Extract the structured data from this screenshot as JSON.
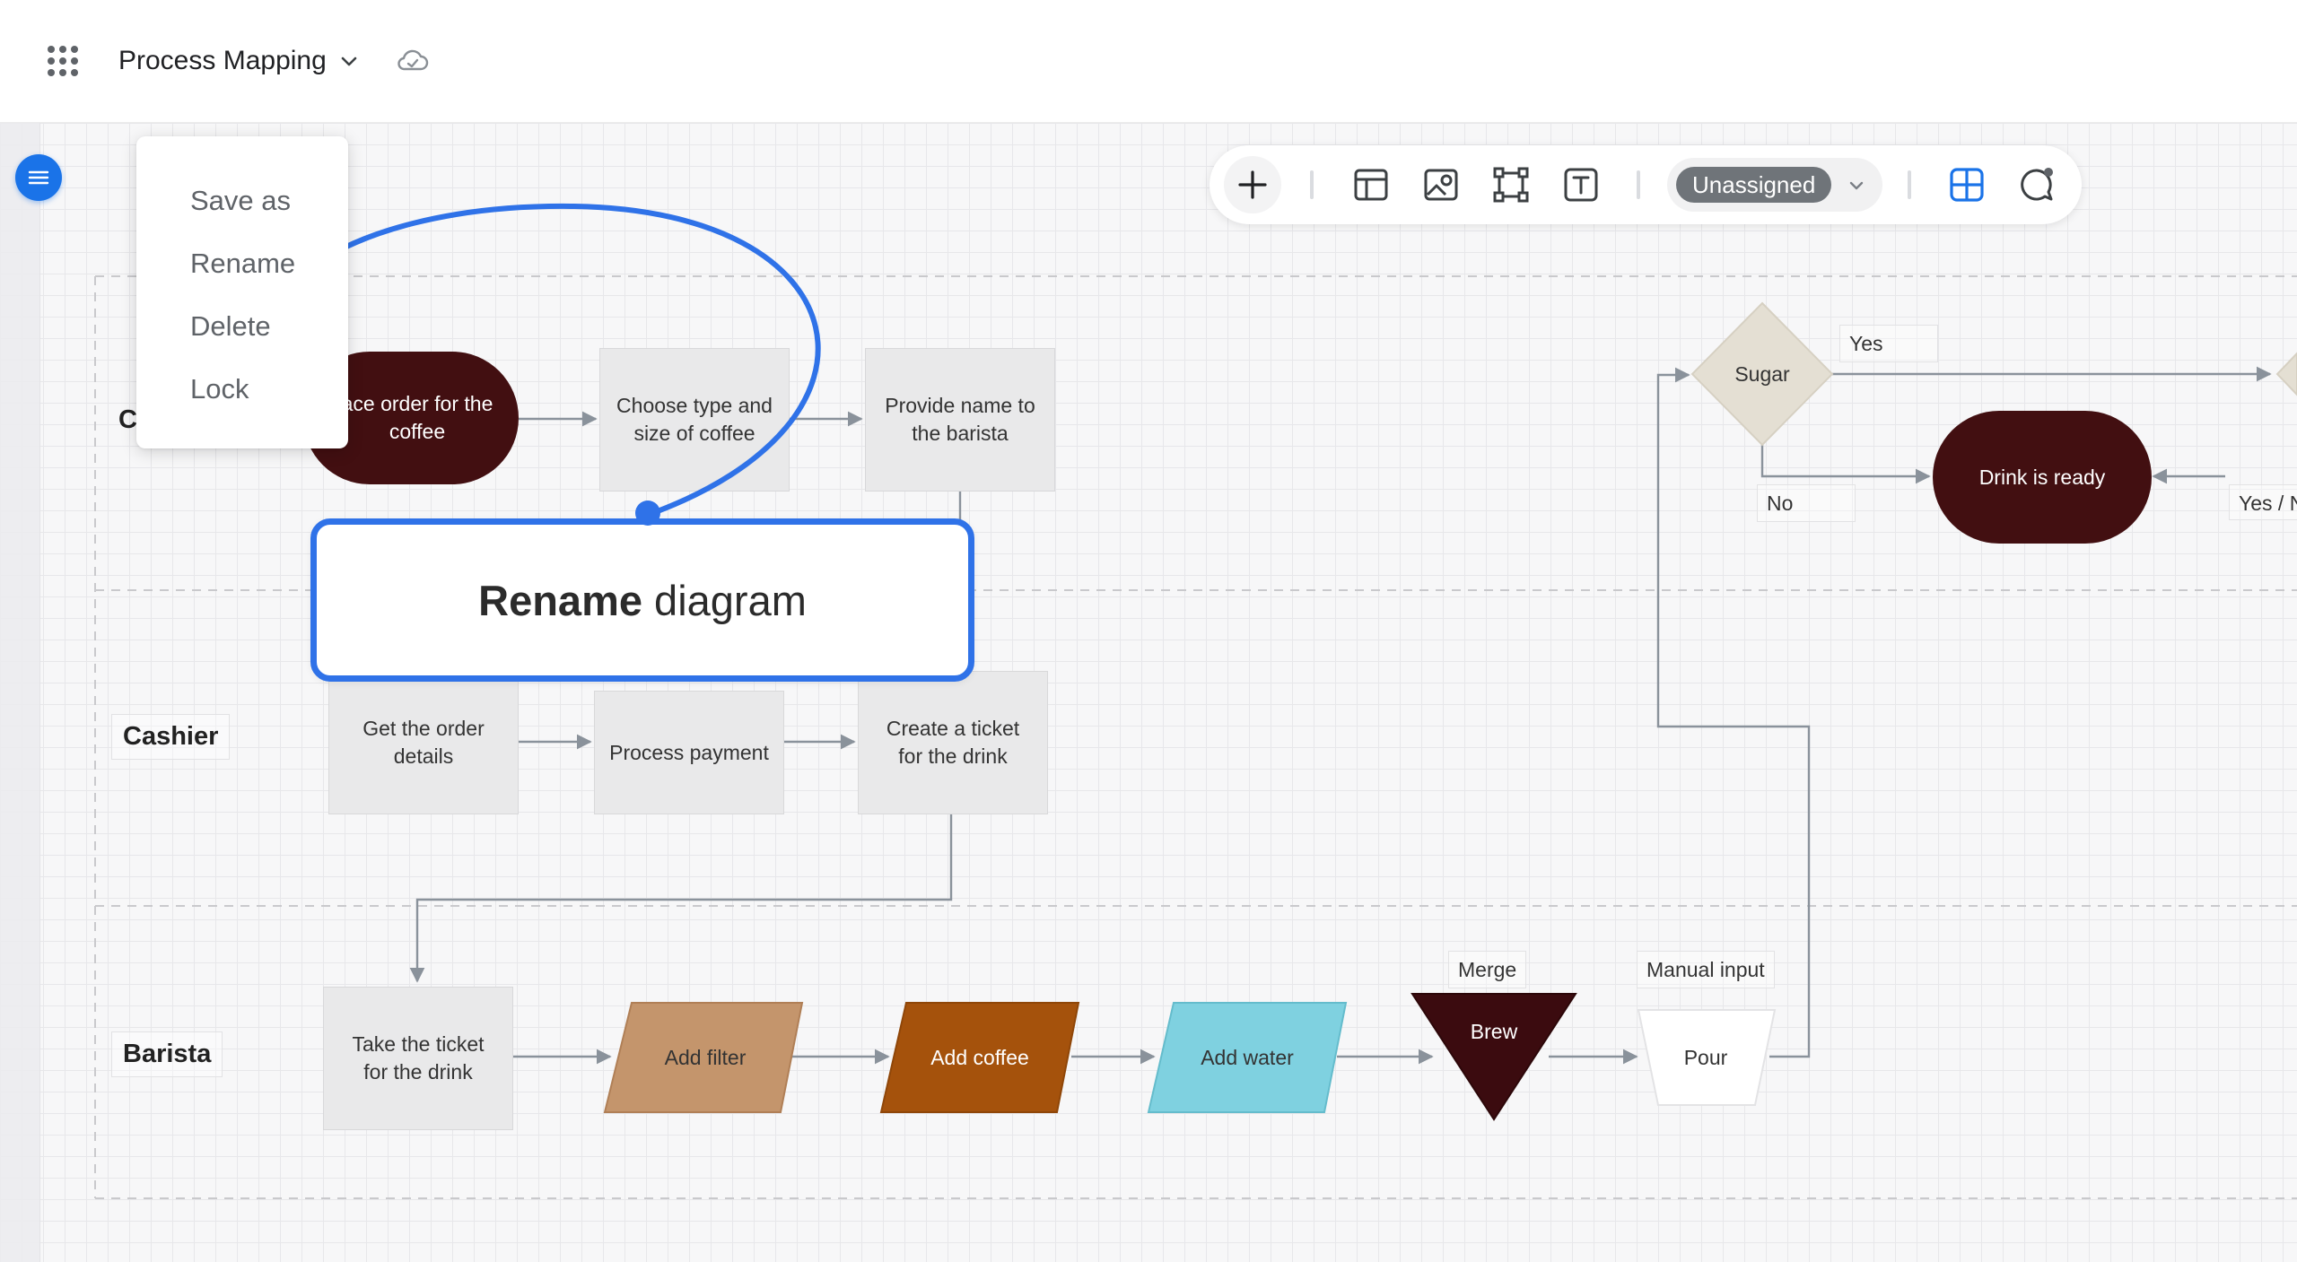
{
  "header": {
    "title": "Process Mapping"
  },
  "menu": {
    "items": [
      "Save as",
      "Rename",
      "Delete",
      "Lock"
    ]
  },
  "toolbar": {
    "assignee": "Unassigned"
  },
  "callout": {
    "bold": "Rename",
    "rest": " diagram"
  },
  "lanes": {
    "customer_partial": "C",
    "cashier": "Cashier",
    "barista": "Barista"
  },
  "nodes": {
    "place_order": "ace order for the coffee",
    "choose_type": "Choose type and size of coffee",
    "provide_name": "Provide name to the barista",
    "get_order": "Get the order details",
    "process_payment": "Process payment",
    "create_ticket": "Create a ticket for the drink",
    "take_ticket": "Take the ticket for the drink",
    "add_filter": "Add filter",
    "add_coffee": "Add coffee",
    "add_water": "Add water",
    "brew": "Brew",
    "pour": "Pour",
    "sugar": "Sugar",
    "drink_ready": "Drink is ready"
  },
  "labels": {
    "merge": "Merge",
    "manual_input": "Manual input",
    "yes": "Yes",
    "no": "No",
    "yes_no_partial": "Yes / N"
  },
  "colors": {
    "accent": "#2f72e8",
    "terminal": "#420f11",
    "filter": "#c4956c",
    "coffee": "#a5520c",
    "water": "#7fd1e0",
    "brew": "#3b0b0f",
    "decision": "#e4dfd3",
    "connector": "#8a929b"
  }
}
